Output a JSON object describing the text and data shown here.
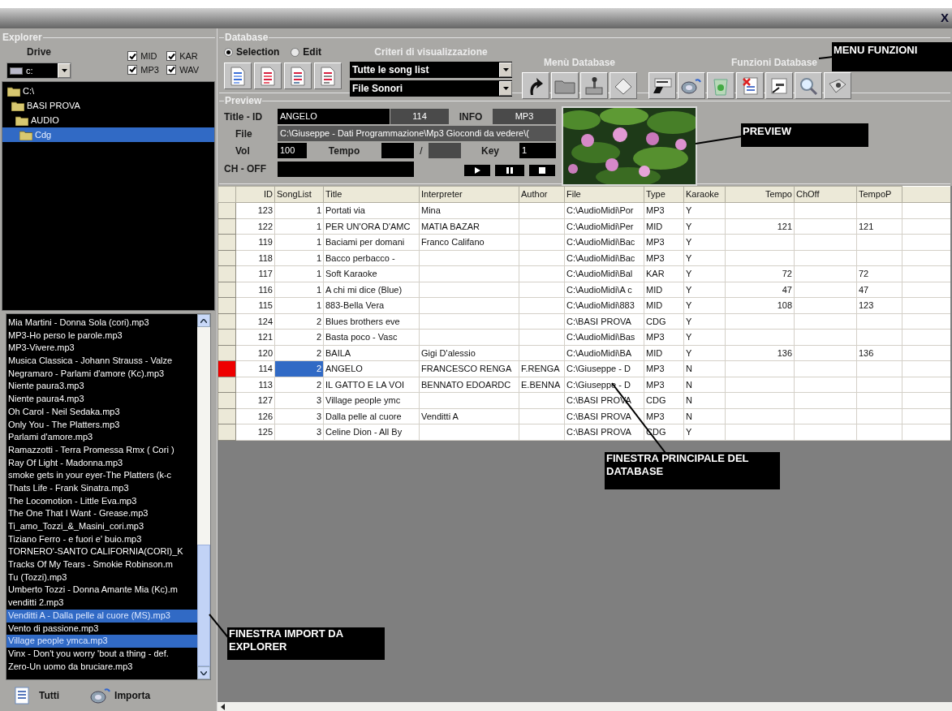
{
  "window": {
    "close": "X"
  },
  "explorer": {
    "title": "Explorer",
    "drive_label": "Drive",
    "drive": "c:",
    "file_types": [
      {
        "label": "MID",
        "checked": true
      },
      {
        "label": "KAR",
        "checked": true
      },
      {
        "label": "MP3",
        "checked": true
      },
      {
        "label": "WAV",
        "checked": true
      }
    ],
    "tree": [
      {
        "label": "C:\\",
        "selected": false,
        "children": [
          {
            "label": "BASI PROVA",
            "selected": false,
            "children": [
              {
                "label": "AUDIO",
                "selected": false,
                "children": [
                  {
                    "label": "Cdg",
                    "selected": true
                  }
                ]
              }
            ]
          }
        ]
      }
    ]
  },
  "files": [
    {
      "label": "Mia Martini - Donna Sola (cori).mp3",
      "selected": false
    },
    {
      "label": "MP3-Ho perso le parole.mp3",
      "selected": false
    },
    {
      "label": "MP3-Vivere.mp3",
      "selected": false
    },
    {
      "label": "Musica Classica - Johann Strauss - Valze",
      "selected": false
    },
    {
      "label": "Negramaro - Parlami d'amore (Kc).mp3",
      "selected": false
    },
    {
      "label": "Niente paura3.mp3",
      "selected": false
    },
    {
      "label": "Niente paura4.mp3",
      "selected": false
    },
    {
      "label": "Oh Carol - Neil Sedaka.mp3",
      "selected": false
    },
    {
      "label": "Only You - The Platters.mp3",
      "selected": false
    },
    {
      "label": "Parlami d'amore.mp3",
      "selected": false
    },
    {
      "label": "Ramazzotti - Terra Promessa Rmx ( Cori )",
      "selected": false
    },
    {
      "label": "Ray Of Light - Madonna.mp3",
      "selected": false
    },
    {
      "label": "smoke gets in your eyer-The Platters (k-c",
      "selected": false
    },
    {
      "label": "Thats Life - Frank Sinatra.mp3",
      "selected": false
    },
    {
      "label": "The Locomotion - Little Eva.mp3",
      "selected": false
    },
    {
      "label": "The One That I Want - Grease.mp3",
      "selected": false
    },
    {
      "label": "Ti_amo_Tozzi_&_Masini_cori.mp3",
      "selected": false
    },
    {
      "label": "Tiziano Ferro - e fuori e' buio.mp3",
      "selected": false
    },
    {
      "label": "TORNERO'-SANTO CALIFORNIA(CORI)_K",
      "selected": false
    },
    {
      "label": "Tracks Of My Tears - Smokie Robinson.m",
      "selected": false
    },
    {
      "label": "Tu (Tozzi).mp3",
      "selected": false
    },
    {
      "label": "Umberto Tozzi - Donna Amante Mia (Kc).m",
      "selected": false
    },
    {
      "label": "venditti 2.mp3",
      "selected": false
    },
    {
      "label": "Venditti A - Dalla pelle al cuore (MS).mp3",
      "selected": true
    },
    {
      "label": "Vento di passione.mp3",
      "selected": false
    },
    {
      "label": "Village people ymca.mp3",
      "selected": true
    },
    {
      "label": "Vinx - Don't you worry 'bout a thing - def.",
      "selected": false
    },
    {
      "label": "Zero-Un uomo da bruciare.mp3",
      "selected": false
    }
  ],
  "bottom_buttons": [
    "Tutti",
    "Importa"
  ],
  "database": {
    "title": "Database",
    "modes": [
      {
        "label": "Selection",
        "selected": true
      },
      {
        "label": "Edit",
        "selected": false
      }
    ],
    "criteria_title": "Criteri di visualizzazione",
    "criteria": [
      "Tutte le song list",
      "File Sonori"
    ],
    "menu_title": "Menù Database",
    "functions_title": "Funzioni Database"
  },
  "preview": {
    "title": "Preview",
    "title_id_label": "Title - ID",
    "title_value": "ANGELO",
    "id_value": "114",
    "info_label": "INFO",
    "info_value": "MP3",
    "file_label": "File",
    "file_value": "C:\\Giuseppe - Dati Programmazione\\Mp3 Giocondi da vedere\\(",
    "vol_label": "Vol",
    "vol_value": "100",
    "tempo_label": "Tempo",
    "tempo_separator": "/",
    "key_label": "Key",
    "key_value": "1",
    "choff_label": "CH - OFF"
  },
  "table": {
    "columns": [
      "ID",
      "SongList",
      "Title",
      "Interpreter",
      "Author",
      "File",
      "Type",
      "Karaoke",
      "Tempo",
      "ChOff",
      "TempoP"
    ],
    "rows": [
      {
        "selected": false,
        "cells": [
          "123",
          "1",
          "Portati via",
          "Mina",
          null,
          "C:\\AudioMidi\\Por",
          "MP3",
          "Y",
          null,
          null,
          null
        ]
      },
      {
        "selected": false,
        "cells": [
          "122",
          "1",
          "PER UN'ORA D'AMC",
          "MATIA BAZAR",
          null,
          "C:\\AudioMidi\\Per",
          "MID",
          "Y",
          "121",
          null,
          "121"
        ]
      },
      {
        "selected": false,
        "cells": [
          "119",
          "1",
          "Baciami per domani",
          "Franco Califano",
          null,
          "C:\\AudioMidi\\Bac",
          "MP3",
          "Y",
          null,
          null,
          null
        ]
      },
      {
        "selected": false,
        "cells": [
          "118",
          "1",
          "Bacco perbacco -",
          null,
          null,
          "C:\\AudioMidi\\Bac",
          "MP3",
          "Y",
          null,
          null,
          null
        ]
      },
      {
        "selected": false,
        "cells": [
          "117",
          "1",
          "Soft Karaoke",
          null,
          null,
          "C:\\AudioMidi\\Bal",
          "KAR",
          "Y",
          "72",
          null,
          "72"
        ]
      },
      {
        "selected": false,
        "cells": [
          "116",
          "1",
          "A chi mi dice (Blue)",
          null,
          null,
          "C:\\AudioMidi\\A c",
          "MID",
          "Y",
          "47",
          null,
          "47"
        ]
      },
      {
        "selected": false,
        "cells": [
          "115",
          "1",
          "883-Bella Vera",
          null,
          null,
          "C:\\AudioMidi\\883",
          "MID",
          "Y",
          "108",
          null,
          "123"
        ]
      },
      {
        "selected": false,
        "cells": [
          "124",
          "2",
          "Blues brothers eve",
          null,
          null,
          "C:\\BASI PROVA",
          "CDG",
          "Y",
          null,
          null,
          null
        ]
      },
      {
        "selected": false,
        "cells": [
          "121",
          "2",
          "Basta poco - Vasc",
          null,
          null,
          "C:\\AudioMidi\\Bas",
          "MP3",
          "Y",
          null,
          null,
          null
        ]
      },
      {
        "selected": false,
        "cells": [
          "120",
          "2",
          "BAILA",
          "Gigi D'alessio",
          null,
          "C:\\AudioMidi\\BA",
          "MID",
          "Y",
          "136",
          null,
          "136"
        ]
      },
      {
        "selected": true,
        "cells": [
          "114",
          "2",
          "ANGELO",
          "FRANCESCO RENGA",
          "F.RENGA",
          "C:\\Giuseppe - D",
          "MP3",
          "N",
          null,
          null,
          null
        ]
      },
      {
        "selected": false,
        "cells": [
          "113",
          "2",
          "IL GATTO E LA VOI",
          "BENNATO EDOARDC",
          "E.BENNA",
          "C:\\Giuseppe - D",
          "MP3",
          "N",
          null,
          null,
          null
        ]
      },
      {
        "selected": false,
        "cells": [
          "127",
          "3",
          "Village people ymc",
          null,
          null,
          "C:\\BASI PROVA",
          "CDG",
          "N",
          null,
          null,
          null
        ]
      },
      {
        "selected": false,
        "cells": [
          "126",
          "3",
          "Dalla pelle al cuore",
          "Venditti A",
          null,
          "C:\\BASI PROVA",
          "MP3",
          "N",
          null,
          null,
          null
        ]
      },
      {
        "selected": false,
        "cells": [
          "125",
          "3",
          "Celine Dion - All By",
          null,
          null,
          "C:\\BASI PROVA",
          "CDG",
          "Y",
          null,
          null,
          null
        ]
      }
    ]
  },
  "annotations": [
    "MENU FUNZIONI",
    "PREVIEW",
    "FINESTRA PRINCIPALE DEL DATABASE",
    "FINESTRA IMPORT DA EXPLORER"
  ]
}
